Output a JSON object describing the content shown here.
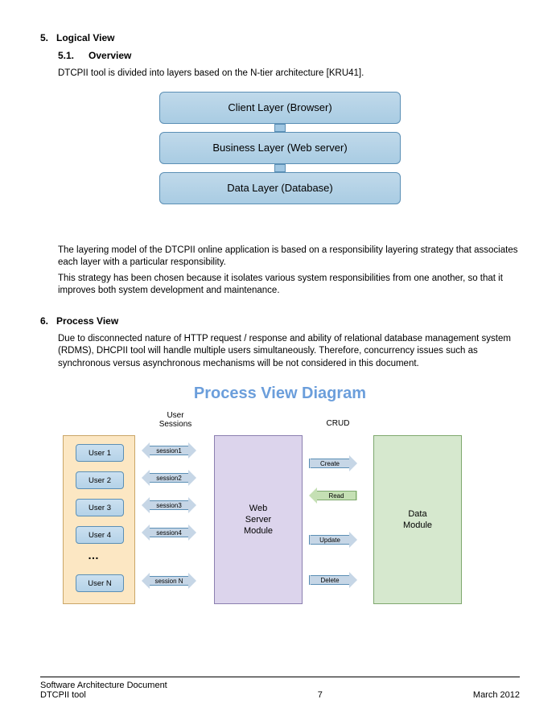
{
  "section5": {
    "num": "5.",
    "title": "Logical View",
    "sub": {
      "num": "5.1.",
      "title": "Overview",
      "intro": "DTCPII tool is divided into layers based on the N-tier architecture [KRU41]."
    },
    "layers": {
      "l1": "Client Layer (Browser)",
      "l2": "Business Layer (Web server)",
      "l3": "Data Layer (Database)"
    },
    "p1": "The layering model of the DTCPII online application is based on a responsibility layering strategy that associates each layer with a particular responsibility.",
    "p2": "This strategy has been chosen because it isolates various system responsibilities from one another, so that it improves both system development and maintenance."
  },
  "section6": {
    "num": "6.",
    "title": "Process View",
    "p1": "Due to disconnected nature of HTTP request / response and ability of relational database management system (RDMS), DHCPII tool will handle multiple users simultaneously. Therefore, concurrency issues such as synchronous versus asynchronous mechanisms will be not considered in this document."
  },
  "pv": {
    "title": "Process View Diagram",
    "col1a": "User",
    "col1b": "Sessions",
    "col2": "CRUD",
    "users": {
      "u1": "User 1",
      "u2": "User 2",
      "u3": "User 3",
      "u4": "User 4",
      "dots": "…",
      "un": "User N"
    },
    "sessions": {
      "s1": "session1",
      "s2": "session2",
      "s3": "session3",
      "s4": "session4",
      "sn": "session N"
    },
    "crud": {
      "c": "Create",
      "r": "Read",
      "u": "Update",
      "d": "Delete"
    },
    "web": "Web\nServer\nModule",
    "web1": "Web",
    "web2": "Server",
    "web3": "Module",
    "data1": "Data",
    "data2": "Module"
  },
  "footer": {
    "doc": "Software Architecture Document",
    "tool": "DTCPII tool",
    "page": "7",
    "date": "March 2012"
  }
}
